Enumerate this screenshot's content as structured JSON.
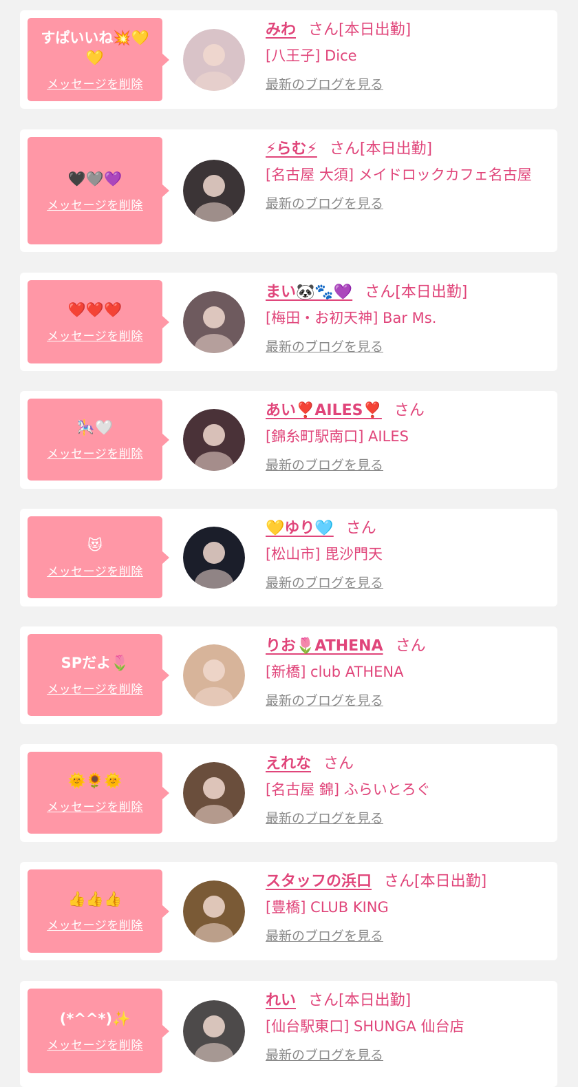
{
  "delete_label": "メッセージを削除",
  "san_label": "さん",
  "blog_label": "最新のブログを見る",
  "cards": [
    {
      "message": "すぱいいね💥💛💛",
      "name": "みわ",
      "attendance": "[本日出勤]",
      "shop": "[八王子] Dice",
      "avatar_color": "#d9c3c8"
    },
    {
      "message": "🖤🩶💜",
      "name": "⚡らむ⚡",
      "attendance": "[本日出勤]",
      "shop": "[名古屋 大須] メイドロックカフェ名古屋",
      "avatar_color": "#3b3436"
    },
    {
      "message": "❤️❤️❤️",
      "name": "まい🐼🐾💜",
      "attendance": "[本日出勤]",
      "shop": "[梅田・お初天神] Bar Ms.",
      "avatar_color": "#6e5a5e"
    },
    {
      "message": "🎠🤍",
      "name": "あい❣️AILES❣️",
      "attendance": "",
      "shop": "[錦糸町駅南口] AILES",
      "avatar_color": "#4a3238"
    },
    {
      "message": "😻",
      "name": "💛ゆり🩵",
      "attendance": "",
      "shop": "[松山市] 毘沙門天",
      "avatar_color": "#1b1e2a"
    },
    {
      "message": "SPだよ🌷",
      "name": "りお🌷ATHENA",
      "attendance": "",
      "shop": "[新橋] club ATHENA",
      "avatar_color": "#d7b49a"
    },
    {
      "message": "🌞🌻🌞",
      "name": "えれな",
      "attendance": "",
      "shop": "[名古屋 錦] ふらいとろぐ",
      "avatar_color": "#6a4e3c"
    },
    {
      "message": "👍👍👍",
      "name": "スタッフの浜口",
      "attendance": "[本日出勤]",
      "shop": "[豊橋] CLUB KING",
      "avatar_color": "#7a5a36"
    },
    {
      "message": "(*^^*)✨",
      "name": "れい",
      "attendance": "[本日出勤]",
      "shop": "[仙台駅東口] SHUNGA 仙台店",
      "avatar_color": "#4d4a4a"
    }
  ]
}
